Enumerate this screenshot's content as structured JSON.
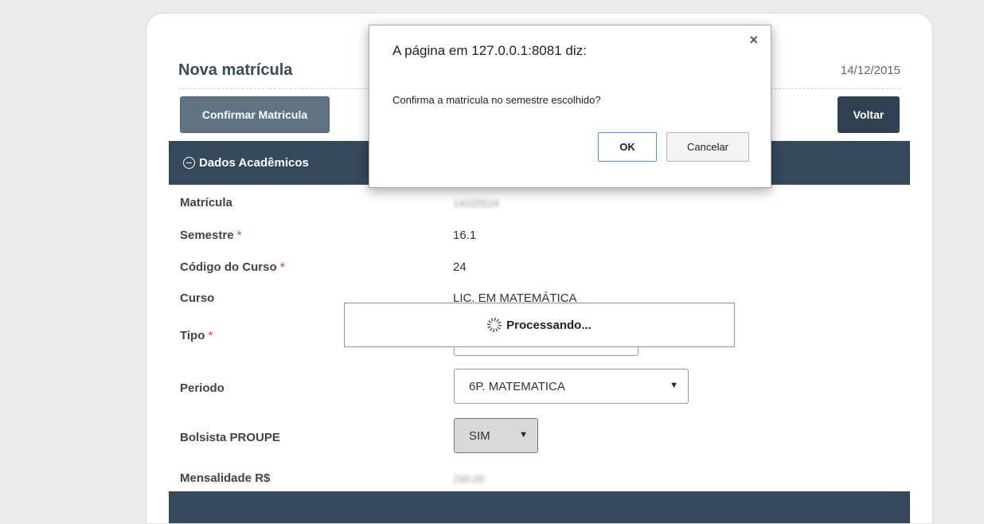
{
  "page": {
    "title": "Nova matrícula",
    "date": "14/12/2015",
    "confirm_button": "Confirmar Matricula",
    "back_button": "Voltar"
  },
  "section": {
    "title": "Dados Acadêmicos",
    "toggle_icon": "collapse-minus-icon"
  },
  "form": {
    "required_mark": "*",
    "matricula": {
      "label": "Matrícula",
      "value": "14020524"
    },
    "semestre": {
      "label": "Semestre",
      "value": "16.1"
    },
    "codigo_curso": {
      "label": "Código do Curso",
      "value": "24"
    },
    "curso": {
      "label": "Curso",
      "value": "LIC. EM MATEMÁTICA"
    },
    "tipo": {
      "label": "Tipo"
    },
    "periodo": {
      "label": "Periodo",
      "selected": "6P. MATEMATICA"
    },
    "bolsista": {
      "label": "Bolsista PROUPE",
      "selected": "SIM"
    },
    "mensalidade": {
      "label": "Mensalidade R$",
      "value": "290,00"
    }
  },
  "processing": {
    "text": "Processando...",
    "icon": "spinner-icon"
  },
  "dialog": {
    "title": "A página em 127.0.0.1:8081 diz:",
    "close": "×",
    "message": "Confirma a matrícula no semestre escolhido?",
    "ok_label": "OK",
    "cancel_label": "Cancelar"
  },
  "colors": {
    "header_bar": "#35495c",
    "confirm_button": "#5f7383",
    "back_button": "#2f4153",
    "required": "#e04040",
    "ok_focus": "#4d90fe"
  }
}
